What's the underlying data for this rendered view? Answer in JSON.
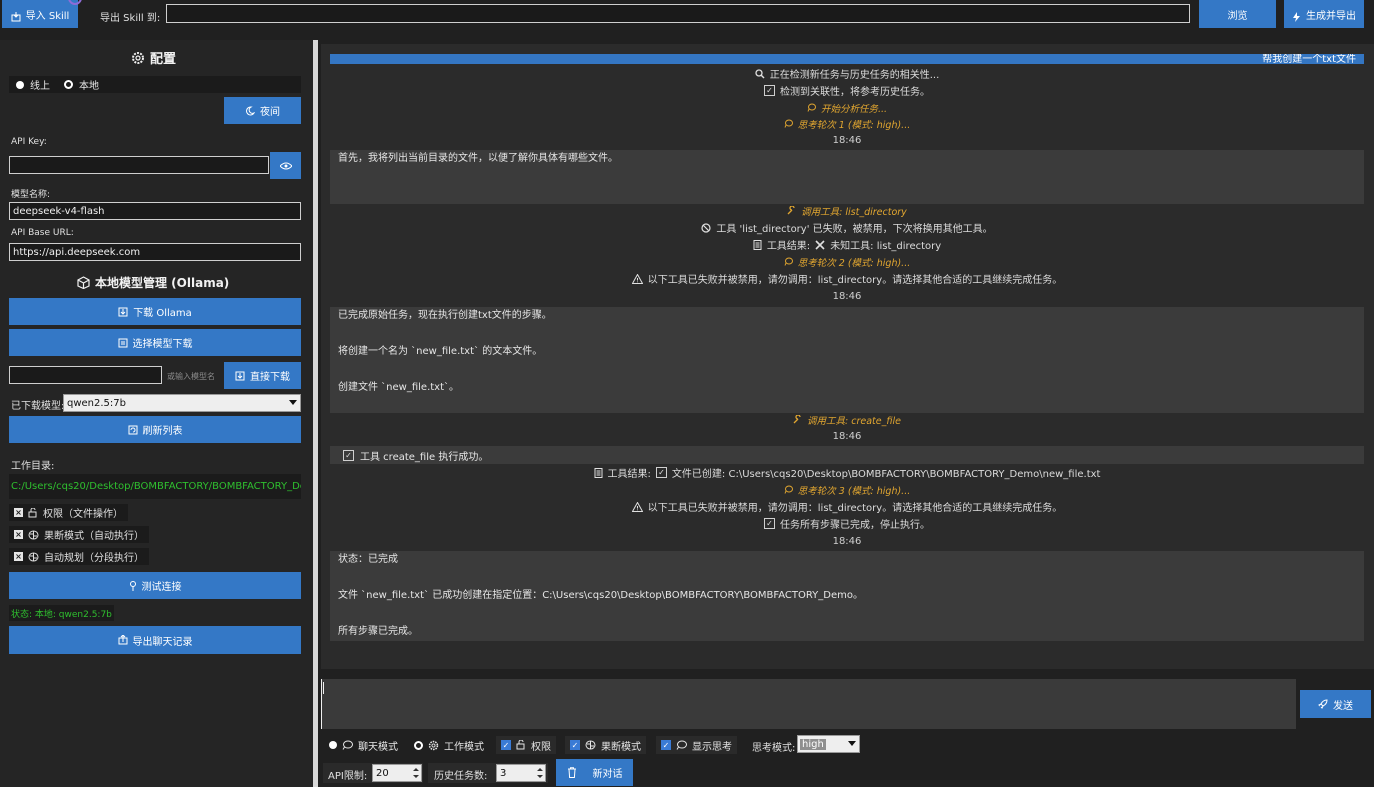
{
  "topbar": {
    "import_skill": "导入 Skill",
    "export_skill_to": "导出 Skill 到:",
    "export_path": "",
    "browse": "浏览",
    "generate_export": "生成并导出"
  },
  "config": {
    "title": "配置",
    "mode_online": "线上",
    "mode_local": "本地",
    "night_button": "夜间",
    "api_key_label": "API Key:",
    "api_key_value": "",
    "model_name_label": "模型名称:",
    "model_name_value": "deepseek-v4-flash",
    "base_url_label": "API Base URL:",
    "base_url_value": "https://api.deepseek.com"
  },
  "ollama": {
    "title": "本地模型管理 (Ollama)",
    "download_ollama": "下载 Ollama",
    "choose_model_download": "选择模型下载",
    "model_input_placeholder": "或输入模型名",
    "direct_download": "直接下载",
    "downloaded_label": "已下载模型:",
    "downloaded_value": "qwen2.5:7b",
    "refresh_list": "刷新列表"
  },
  "workdir": {
    "label": "工作目录:",
    "path": "C:/Users/cqs20/Desktop/BOMBFACTORY/BOMBFACTORY_De"
  },
  "options": [
    {
      "label": "权限（文件操作）"
    },
    {
      "label": "果断模式（自动执行）"
    },
    {
      "label": "自动规划（分段执行）"
    }
  ],
  "test_connection": "测试连接",
  "status_text": "状态: 本地: qwen2.5:7b",
  "export_chat": "导出聊天记录",
  "chat": {
    "user_message": "帮我创建一个txt文件",
    "lines_a": [
      "正在检测新任务与历史任务的相关性...",
      "检测到关联性，将参考历史任务。",
      "开始分析任务...",
      "思考轮次 1 (模式: high)...",
      "18:46"
    ],
    "bubble1": [
      "首先，我将列出当前目录的文件，以便了解你具体有哪些文件。"
    ],
    "lines_b": [
      "调用工具: list_directory",
      "工具 'list_directory' 已失败，被禁用，下次将换用其他工具。",
      "工具结果:",
      "未知工具: list_directory",
      "思考轮次 2 (模式: high)...",
      "以下工具已失败并被禁用，请勿调用：list_directory。请选择其他合适的工具继续完成任务。",
      "18:46"
    ],
    "bubble2": [
      "已完成原始任务，现在执行创建txt文件的步骤。",
      "",
      "将创建一个名为 `new_file.txt` 的文本文件。",
      "",
      "创建文件 `new_file.txt`。"
    ],
    "lines_c": [
      "调用工具: create_file",
      "18:46"
    ],
    "tool_success": "工具 create_file 执行成功。",
    "lines_d": [
      "工具结果:",
      "文件已创建: C:\\Users\\cqs20\\Desktop\\BOMBFACTORY\\BOMBFACTORY_Demo\\new_file.txt",
      "思考轮次 3 (模式: high)...",
      "以下工具已失败并被禁用，请勿调用：list_directory。请选择其他合适的工具继续完成任务。",
      "任务所有步骤已完成，停止执行。",
      "18:46"
    ],
    "bubble3": [
      "状态：已完成",
      "",
      "文件 `new_file.txt` 已成功创建在指定位置：C:\\Users\\cqs20\\Desktop\\BOMBFACTORY\\BOMBFACTORY_Demo。",
      "",
      "所有步骤已完成。"
    ]
  },
  "composer": {
    "input_value": "",
    "send": "发送"
  },
  "bottom": {
    "chat_mode": "聊天模式",
    "work_mode": "工作模式",
    "permission": "权限",
    "decisive_mode": "果断模式",
    "show_thinking": "显示思考",
    "think_mode_label": "思考模式:",
    "think_mode_value": "high",
    "api_limit_label": "API限制:",
    "api_limit_value": "20",
    "history_label": "历史任务数:",
    "history_value": "3",
    "new_chat": "新对话"
  },
  "colors": {
    "accent": "#3478c6",
    "think": "#e1a630",
    "path_green": "#2fbf2f"
  }
}
